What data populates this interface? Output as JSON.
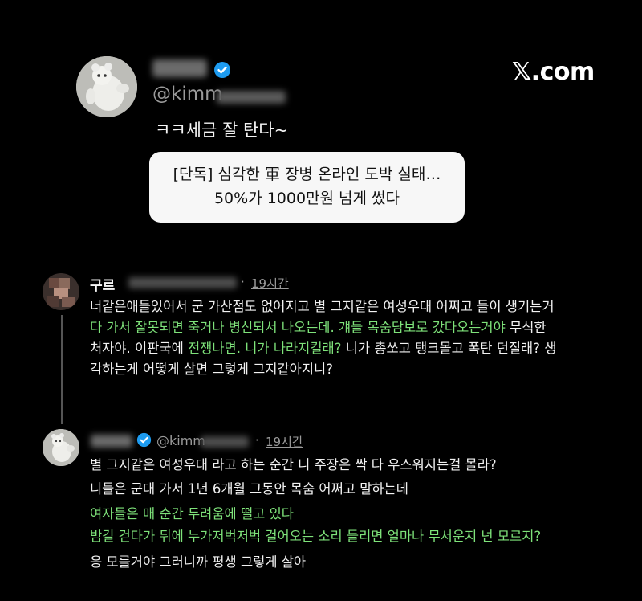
{
  "brand": {
    "site": "𝕏.com"
  },
  "top_tweet": {
    "handle_prefix": "@kimm",
    "text": "ㅋㅋ세금 잘 탄다~",
    "card_line1": "[단독] 심각한 軍 장병 온라인 도박 실태…",
    "card_line2": "50%가 1000만원 넘게 썼다"
  },
  "reply1": {
    "name": "구르",
    "time": "19시간",
    "separator": "·",
    "lines": [
      [
        {
          "t": "너같은애들있어서 군 가산점도 없어지고 별 그지같은 여성우대 어쩌고 들이 생기는거",
          "g": false
        }
      ],
      [
        {
          "t": "다 가서 잘못되면 죽거나 병신되서 나오는데. 걔들 목숨담보로 갔다오는거야",
          "g": true
        },
        {
          "t": " 무식한",
          "g": false
        }
      ],
      [
        {
          "t": "처자야. 이판국에 ",
          "g": false
        },
        {
          "t": "전쟁나면. 니가 나라지킬래?",
          "g": true
        },
        {
          "t": " 니가 총쏘고 탱크몰고 폭탄 던질래? 생",
          "g": false
        }
      ],
      [
        {
          "t": "각하는게 어떻게 살면 그렇게 그지같아지니?",
          "g": false
        }
      ]
    ]
  },
  "reply2": {
    "handle_prefix": "@kimm",
    "time": "19시간",
    "separator": "·",
    "lines": [
      {
        "t": "별 그지같은 여성우대 라고 하는 순간 니 주장은 싹 다 우스워지는걸 몰라?",
        "g": false
      },
      {
        "t": "니들은 군대 가서 1년 6개월 그동안 목숨 어쩌고 말하는데",
        "g": false
      },
      {
        "t": "여자들은 매 순간 두려움에 떨고 있다",
        "g": true
      },
      {
        "t": "밤길 걷다가 뒤에 누가저벅저벅 걸어오는 소리 들리면 얼마나 무서운지 넌 모르지?",
        "g": true
      },
      {
        "t": "응 모를거야 그러니까 평생 그렇게 살아",
        "g": false
      }
    ]
  },
  "colors": {
    "background": "#000000",
    "green_text": "#7ee27a",
    "verified_blue": "#1d9bf0",
    "card_bg": "#f7f7f7"
  },
  "icons": [
    "verified-badge-icon",
    "x-logo"
  ]
}
